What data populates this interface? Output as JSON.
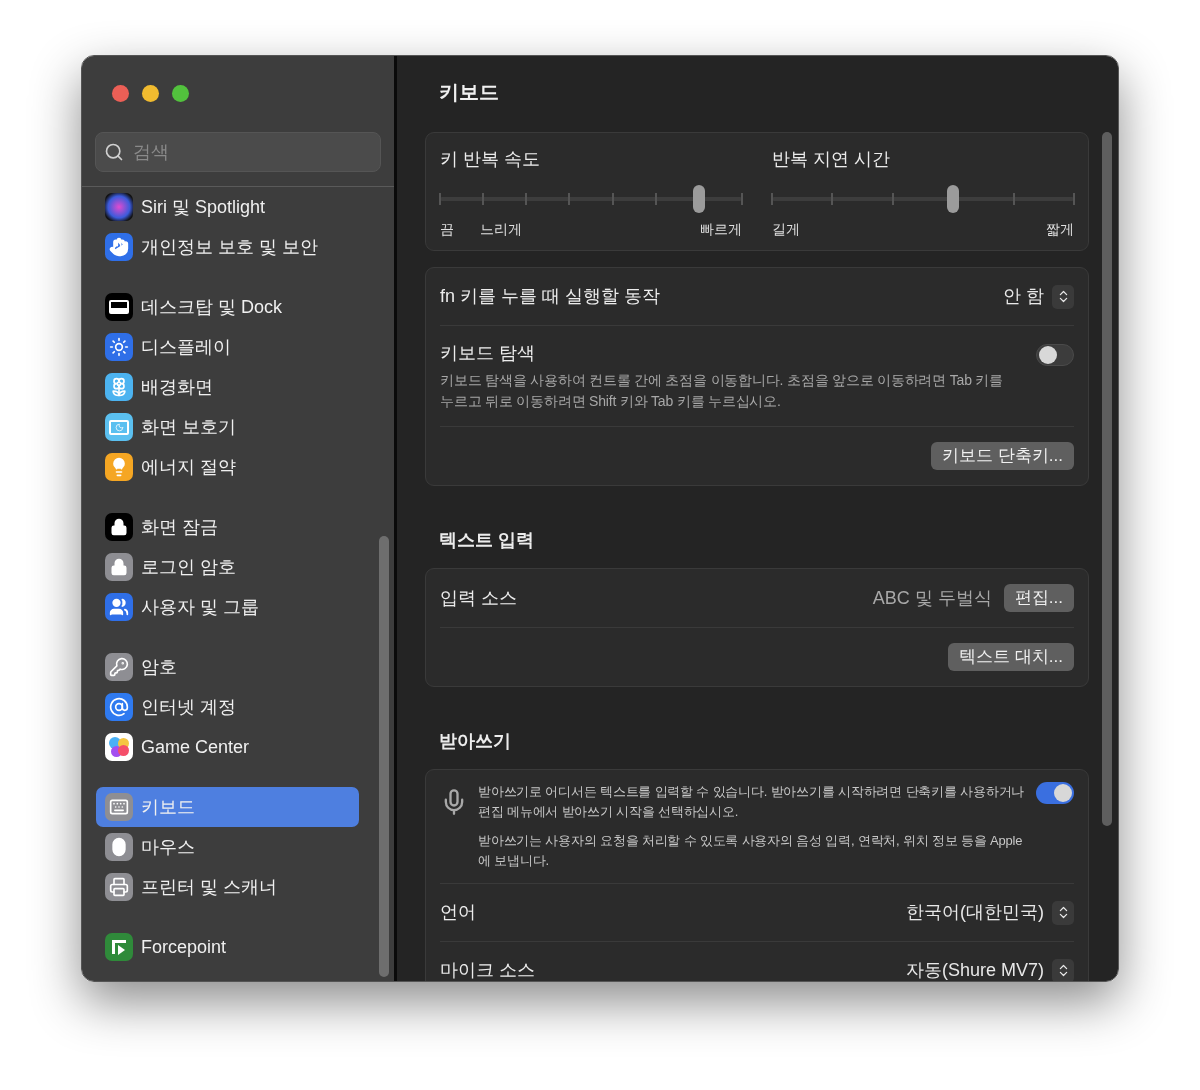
{
  "window": {
    "title": "키보드"
  },
  "sidebar": {
    "search": {
      "placeholder": "검색"
    },
    "groups": [
      {
        "items": [
          {
            "label": "Siri 및 Spotlight",
            "selected": false
          },
          {
            "label": "개인정보 보호 및 보안",
            "selected": false
          }
        ]
      },
      {
        "items": [
          {
            "label": "데스크탑 및 Dock",
            "selected": false
          },
          {
            "label": "디스플레이",
            "selected": false
          },
          {
            "label": "배경화면",
            "selected": false
          },
          {
            "label": "화면 보호기",
            "selected": false
          },
          {
            "label": "에너지 절약",
            "selected": false
          }
        ]
      },
      {
        "items": [
          {
            "label": "화면 잠금",
            "selected": false
          },
          {
            "label": "로그인 암호",
            "selected": false
          },
          {
            "label": "사용자 및 그룹",
            "selected": false
          }
        ]
      },
      {
        "items": [
          {
            "label": "암호",
            "selected": false
          },
          {
            "label": "인터넷 계정",
            "selected": false
          },
          {
            "label": "Game Center",
            "selected": false
          }
        ]
      },
      {
        "items": [
          {
            "label": "키보드",
            "selected": true
          },
          {
            "label": "마우스",
            "selected": false
          },
          {
            "label": "프린터 및 스캐너",
            "selected": false
          }
        ]
      },
      {
        "items": [
          {
            "label": "Forcepoint",
            "selected": false
          }
        ]
      }
    ]
  },
  "sliders": [
    {
      "label": "키 반복 속도",
      "level": 0.857,
      "scale_labels": [
        "끔",
        "느리게",
        "빠르게"
      ]
    },
    {
      "label": "반복 지연 시간",
      "level": 0.6,
      "scale_labels": [
        "길게",
        "짧게"
      ]
    }
  ],
  "sections": [
    {
      "rows": [
        {
          "kind": "popup",
          "label": "fn 키를 누를 때 실행할 동작",
          "value": "안 함"
        },
        {
          "kind": "toggle",
          "label": "키보드 탐색",
          "description": "키보드 탐색을 사용하여 컨트롤 간에 초점을 이동합니다. 초점을 앞으로 이동하려면 Tab 키를 누르고 뒤로 이동하려면 Shift 키와 Tab 키를 누르십시오.",
          "on": false
        },
        {
          "kind": "button",
          "button": "키보드 단축키..."
        }
      ]
    },
    {
      "title": "텍스트 입력",
      "rows": [
        {
          "kind": "value_button",
          "label": "입력 소스",
          "value": "ABC 및 두벌식",
          "button": "편집..."
        },
        {
          "kind": "button",
          "button": "텍스트 대치..."
        }
      ]
    },
    {
      "title": "받아쓰기",
      "rows": [
        {
          "kind": "dictation",
          "paragraphs": [
            "받아쓰기로 어디서든 텍스트를 입력할 수 있습니다. 받아쓰기를 시작하려면 단축키를 사용하거나 편집 메뉴에서 받아쓰기 시작을 선택하십시오.",
            "받아쓰기는 사용자의 요청을 처리할 수 있도록 사용자의 음성 입력, 연락처, 위치 정보 등을 Apple에 보냅니다."
          ],
          "on": true
        },
        {
          "kind": "popup",
          "label": "언어",
          "value": "한국어(대한민국)"
        },
        {
          "kind": "popup",
          "label": "마이크 소스",
          "value": "자동(Shure MV7)"
        }
      ]
    }
  ]
}
